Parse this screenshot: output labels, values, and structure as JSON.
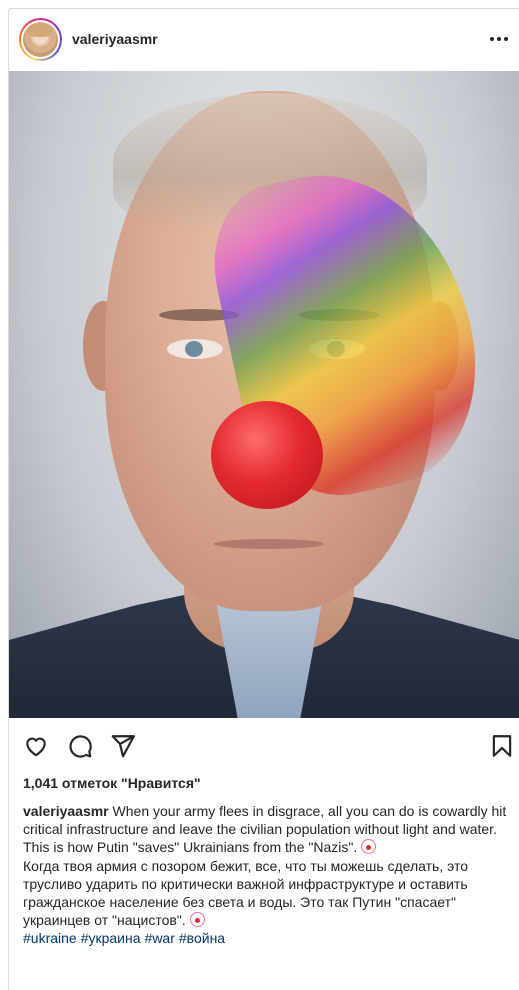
{
  "post": {
    "username": "valeriyaasmr",
    "likes_text": "1,041 отметок \"Нравится\"",
    "caption_en": " When your army flees in disgrace, all you can do is cowardly hit critical infrastructure and leave the civilian population without light and water. This is how Putin \"saves\" Ukrainians from the \"Nazis\". ",
    "caption_ru": "Когда твоя армия с позором бежит, все, что ты можешь сделать, это трусливо ударить по критически важной инфраструктуре и оставить гражданское население без света и воды. Это так Путин \"спасает\" украинцев от \"нацистов\". ",
    "hashtags": [
      "#ukraine",
      "#украина",
      "#war",
      "#война"
    ]
  },
  "icons": {
    "more": "more-options-icon",
    "like": "heart-icon",
    "comment": "comment-icon",
    "share": "send-icon",
    "save": "bookmark-icon",
    "emoji": "clown-face-icon"
  },
  "colors": {
    "text": "#262626",
    "hashtag": "#00376b",
    "border": "#dbdbdb"
  }
}
